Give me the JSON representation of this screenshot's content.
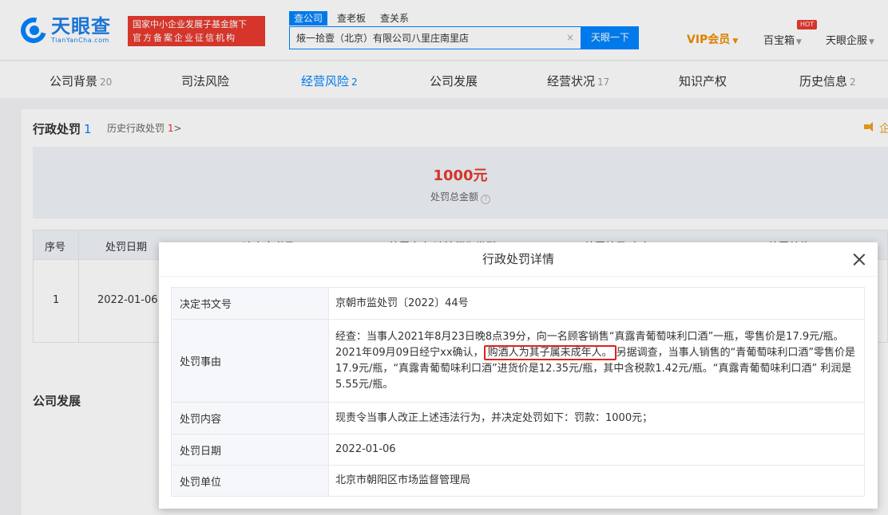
{
  "header": {
    "logo_cn": "天眼查",
    "logo_en": "TianYanCha.com",
    "badge_line1": "国家中小企业发展子基金旗下",
    "badge_line2": "官方备案企业征信机构",
    "search_tabs": [
      "查公司",
      "查老板",
      "查关系"
    ],
    "search_value": "焲一拾壹（北京）有限公司八里庄南里店",
    "search_clear": "×",
    "search_button": "天眼一下",
    "vip": "VIP会员",
    "baibaoxiang": "百宝箱",
    "hot": "HOT",
    "qifu": "天眼企服"
  },
  "nav": [
    {
      "label": "公司背景",
      "count": "20"
    },
    {
      "label": "司法风险",
      "count": ""
    },
    {
      "label": "经营风险",
      "count": "2"
    },
    {
      "label": "公司发展",
      "count": ""
    },
    {
      "label": "经营状况",
      "count": "17"
    },
    {
      "label": "知识产权",
      "count": ""
    },
    {
      "label": "历史信息",
      "count": "2"
    }
  ],
  "section": {
    "title": "行政处罚",
    "count": "1",
    "history_link": "历史行政处罚",
    "history_count": "1",
    "history_arrow": ">",
    "speaker_text": "企",
    "total_amount": "1000元",
    "total_label": "处罚总金额",
    "table_headers": [
      "序号",
      "处罚日期",
      "决定文书号",
      "处罚事由/违法行为类型",
      "处罚结果/内容",
      "处罚单位"
    ],
    "row": {
      "index": "1",
      "date": "2022-01-06"
    },
    "next_section_title": "公司发展"
  },
  "modal": {
    "title": "行政处罚详情",
    "rows": [
      {
        "key": "决定书文号",
        "value": "京朝市监处罚〔2022〕44号"
      },
      {
        "key": "处罚事由",
        "value_pre": "经查：当事人2021年8月23日晚8点39分，向一名顾客销售“真露青葡萄味利口酒”一瓶，零售价是17.9元/瓶。2021年09月09日经宁xx确认，",
        "value_highlight": "购酒人为其子属未成年人。",
        "value_post": "另据调查，当事人销售的“青葡萄味利口酒”零售价是17.9元/瓶，“真露青葡萄味利口酒”进货价是12.35元/瓶，其中含税款1.42元/瓶。“真露青葡萄味利口酒” 利润是5.55元/瓶。"
      },
      {
        "key": "处罚内容",
        "value": "现责令当事人改正上述违法行为，并决定处罚如下：罚款：1000元；"
      },
      {
        "key": "处罚日期",
        "value": "2022-01-06"
      },
      {
        "key": "处罚单位",
        "value": "北京市朝阳区市场监督管理局"
      }
    ]
  },
  "colors": {
    "brand": "#0084ff",
    "red": "#e83a2e",
    "vip": "#f08c00"
  }
}
